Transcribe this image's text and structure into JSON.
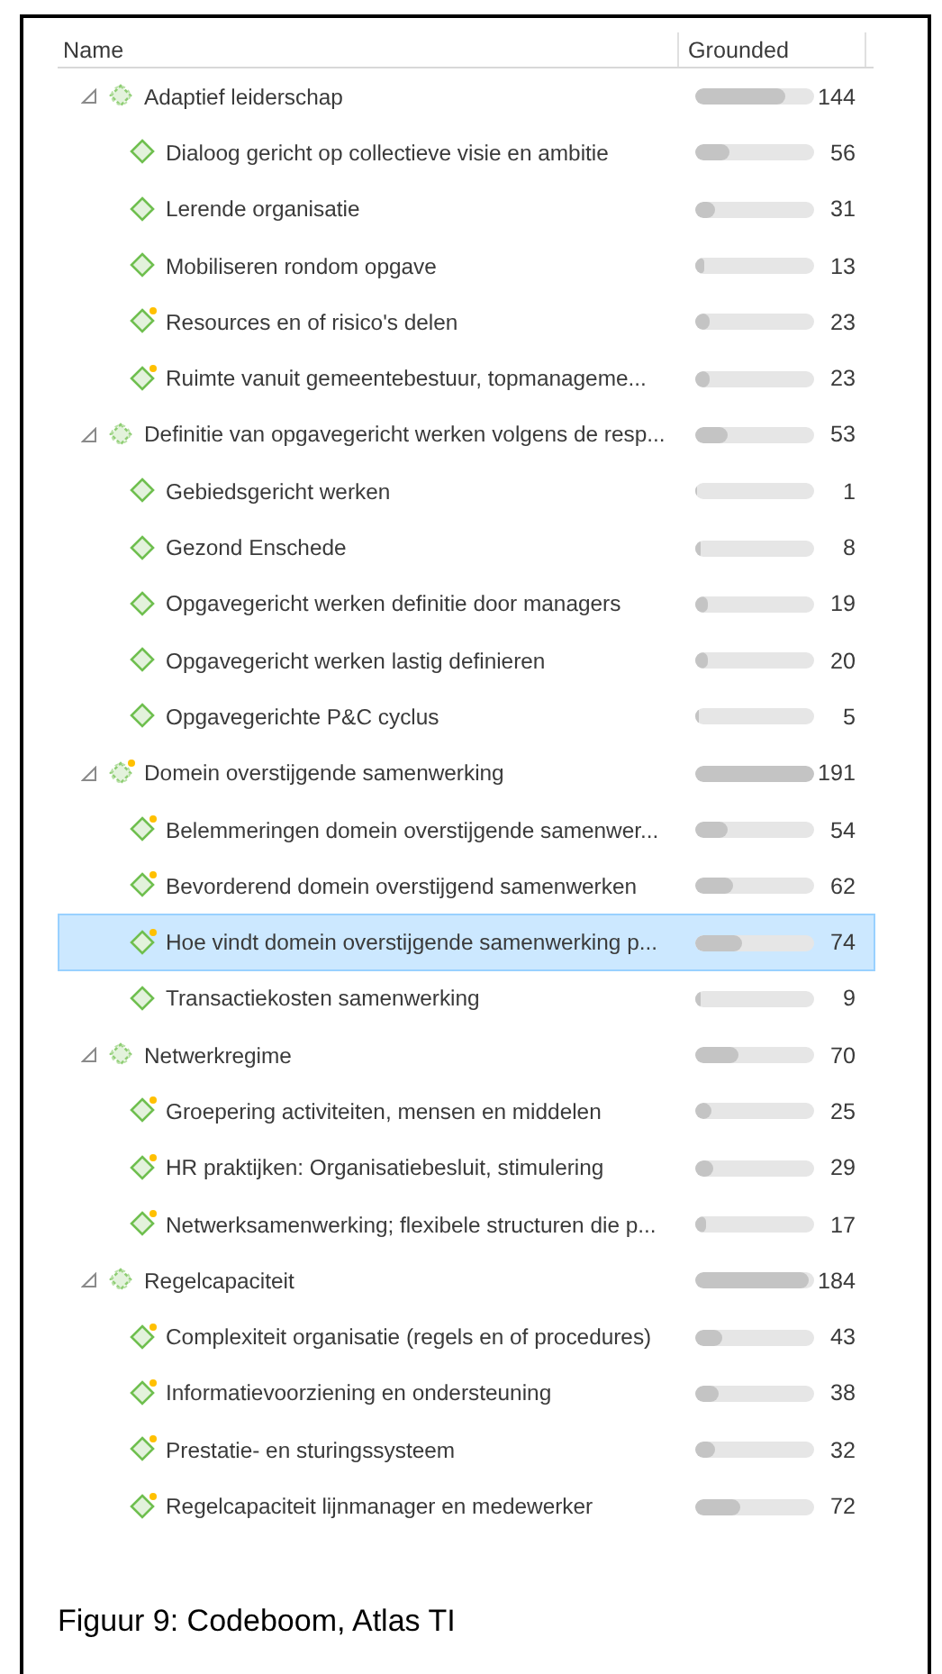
{
  "columns": [
    {
      "label": "Name"
    },
    {
      "label": "Grounded"
    }
  ],
  "groups": [
    {
      "name": "Adaptief leiderschap",
      "grounded": "144",
      "level": 0.75,
      "expanded": true,
      "commented": false,
      "selected": false,
      "children": [
        {
          "name": "Dialoog gericht op collectieve visie en ambitie",
          "grounded": "56",
          "level": 0.29,
          "commented": false,
          "selected": false
        },
        {
          "name": "Lerende organisatie",
          "grounded": "31",
          "level": 0.16,
          "commented": false,
          "selected": false
        },
        {
          "name": "Mobiliseren rondom opgave",
          "grounded": "13",
          "level": 0.07,
          "commented": false,
          "selected": false
        },
        {
          "name": "Resources en of risico's delen",
          "grounded": "23",
          "level": 0.12,
          "commented": true,
          "selected": false
        },
        {
          "name": "Ruimte vanuit gemeentebestuur, topmanageme...",
          "grounded": "23",
          "level": 0.12,
          "commented": true,
          "selected": false
        }
      ]
    },
    {
      "name": "Definitie van opgavegericht werken volgens de resp...",
      "grounded": "53",
      "level": 0.28,
      "expanded": true,
      "commented": false,
      "selected": false,
      "children": [
        {
          "name": "Gebiedsgericht werken",
          "grounded": "1",
          "level": 0.01,
          "commented": false,
          "selected": false
        },
        {
          "name": "Gezond Enschede",
          "grounded": "8",
          "level": 0.04,
          "commented": false,
          "selected": false
        },
        {
          "name": "Opgavegericht werken definitie door managers",
          "grounded": "19",
          "level": 0.1,
          "commented": false,
          "selected": false
        },
        {
          "name": "Opgavegericht werken lastig definieren",
          "grounded": "20",
          "level": 0.1,
          "commented": false,
          "selected": false
        },
        {
          "name": "Opgavegerichte P&C cyclus",
          "grounded": "5",
          "level": 0.03,
          "commented": false,
          "selected": false
        }
      ]
    },
    {
      "name": "Domein overstijgende samenwerking",
      "grounded": "191",
      "level": 1,
      "expanded": true,
      "commented": true,
      "selected": false,
      "children": [
        {
          "name": "Belemmeringen domein overstijgende samenwer...",
          "grounded": "54",
          "level": 0.28,
          "commented": true,
          "selected": false
        },
        {
          "name": "Bevorderend domein overstijgend samenwerken",
          "grounded": "62",
          "level": 0.32,
          "commented": true,
          "selected": false
        },
        {
          "name": "Hoe vindt domein overstijgende samenwerking p...",
          "grounded": "74",
          "level": 0.39,
          "commented": true,
          "selected": true
        },
        {
          "name": "Transactiekosten samenwerking",
          "grounded": "9",
          "level": 0.05,
          "commented": false,
          "selected": false
        }
      ]
    },
    {
      "name": "Netwerkregime",
      "grounded": "70",
      "level": 0.37,
      "expanded": true,
      "commented": false,
      "selected": false,
      "children": [
        {
          "name": "Groepering activiteiten, mensen en middelen",
          "grounded": "25",
          "level": 0.13,
          "commented": true,
          "selected": false
        },
        {
          "name": "HR praktijken: Organisatiebesluit, stimulering",
          "grounded": "29",
          "level": 0.15,
          "commented": true,
          "selected": false
        },
        {
          "name": "Netwerksamenwerking; flexibele structuren die p...",
          "grounded": "17",
          "level": 0.09,
          "commented": true,
          "selected": false
        }
      ]
    },
    {
      "name": "Regelcapaciteit",
      "grounded": "184",
      "level": 0.96,
      "expanded": true,
      "commented": false,
      "selected": false,
      "children": [
        {
          "name": "Complexiteit organisatie (regels en of procedures)",
          "grounded": "43",
          "level": 0.23,
          "commented": true,
          "selected": false
        },
        {
          "name": "Informatievoorziening en ondersteuning",
          "grounded": "38",
          "level": 0.2,
          "commented": true,
          "selected": false
        },
        {
          "name": "Prestatie- en sturingssysteem",
          "grounded": "32",
          "level": 0.17,
          "commented": true,
          "selected": false
        },
        {
          "name": "Regelcapaciteit lijnmanager en medewerker",
          "grounded": "72",
          "level": 0.38,
          "commented": true,
          "selected": false
        }
      ]
    }
  ],
  "caption": "Figuur 9: Codeboom, Atlas TI"
}
